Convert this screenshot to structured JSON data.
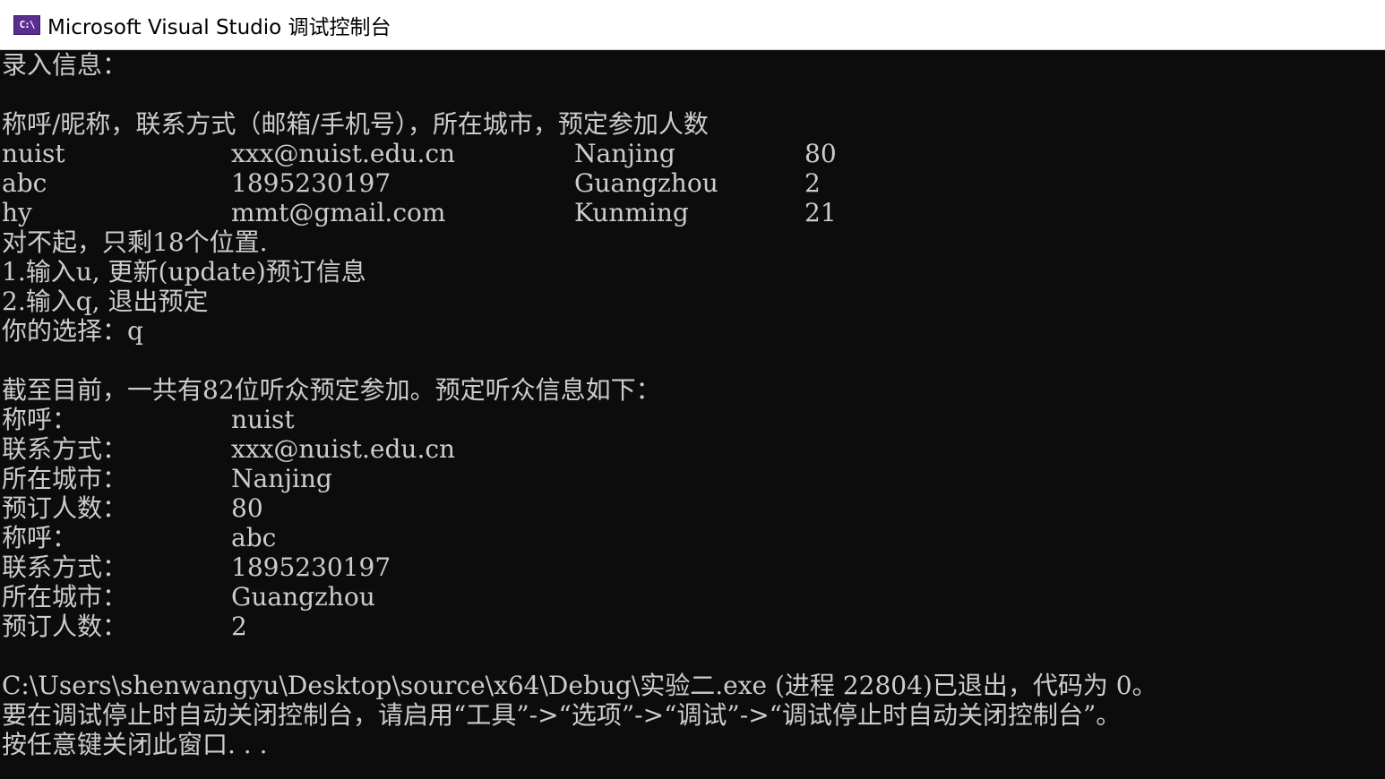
{
  "window": {
    "icon_text": "C:\\",
    "title": "Microsoft Visual Studio 调试控制台"
  },
  "console": {
    "header_prompt": "录入信息：",
    "columns_header": "称呼/昵称，联系方式（邮箱/手机号），所在城市，预定参加人数",
    "rows": [
      {
        "name": "nuist",
        "contact": "xxx@nuist.edu.cn",
        "city": "Nanjing",
        "count": "80"
      },
      {
        "name": "abc",
        "contact": "1895230197",
        "city": "Guangzhou",
        "count": "2"
      },
      {
        "name": "hy",
        "contact": "mmt@gmail.com",
        "city": "Kunming",
        "count": "21"
      }
    ],
    "sorry_msg": "对不起，只剩18个位置.",
    "option1": "1.输入u, 更新(update)预订信息",
    "option2": "2.输入q, 退出预定",
    "choice": "你的选择：q",
    "summary": "截至目前，一共有82位听众预定参加。预定听众信息如下：",
    "label_name": "称呼：",
    "label_contact": "联系方式：",
    "label_city": "所在城市：",
    "label_count": "预订人数：",
    "records": [
      {
        "name": "nuist",
        "contact": "xxx@nuist.edu.cn",
        "city": "Nanjing",
        "count": "80"
      },
      {
        "name": "abc",
        "contact": "1895230197",
        "city": "Guangzhou",
        "count": "2"
      }
    ],
    "exit_msg": "C:\\Users\\shenwangyu\\Desktop\\source\\x64\\Debug\\实验二.exe (进程 22804)已退出，代码为 0。",
    "hint_msg": "要在调试停止时自动关闭控制台，请启用“工具”->“选项”->“调试”->“调试停止时自动关闭控制台”。",
    "press_key_msg": "按任意键关闭此窗口. . ."
  },
  "colors": {
    "console_background": "#0c0c0c",
    "console_text": "#cccccc",
    "titlebar_background": "#ffffff",
    "icon_background": "#5c2d91"
  }
}
